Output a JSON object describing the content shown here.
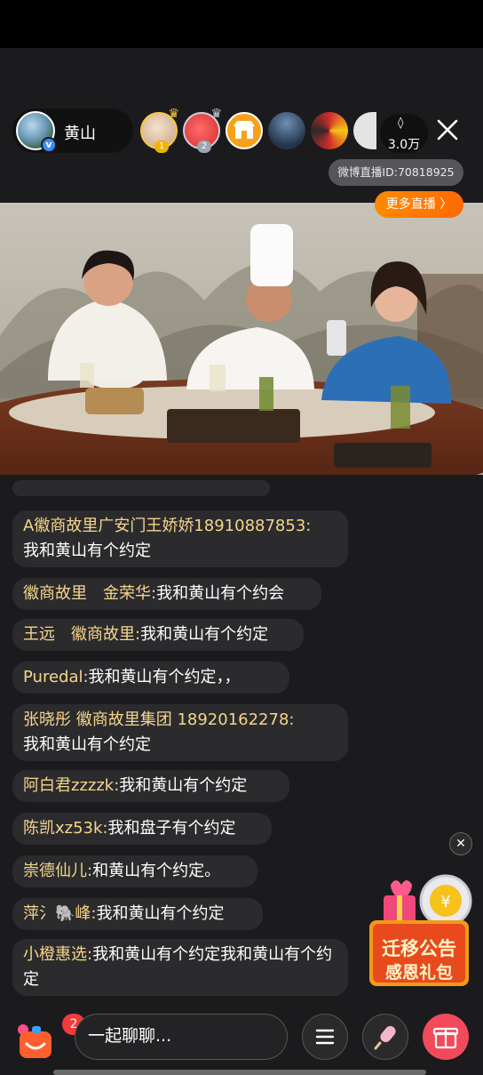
{
  "host": {
    "name": "黄山",
    "verified_mark": "v"
  },
  "viewers": {
    "rank1": "1",
    "rank2": "2",
    "count": "3.0万"
  },
  "room_id": "微博直播ID:70818925",
  "more_live": "更多直播 〉",
  "chat": [
    {
      "user": "A徽商故里广安门王娇娇18910887853:",
      "text": "我和黄山有个约定"
    },
    {
      "user": "徽商故里　金荣华:",
      "text": "我和黄山有个约会"
    },
    {
      "user": "王远　徽商故里:",
      "text": "我和黄山有个约定"
    },
    {
      "user": "Puredal:",
      "text": "我和黄山有个约定，，"
    },
    {
      "user": "张晓彤 徽商故里集团 18920162278:",
      "text": "我和黄山有个约定"
    },
    {
      "user": "阿白君zzzzk:",
      "text": "我和黄山有个约定"
    },
    {
      "user": "陈凯xz53k:",
      "text": "我和盘子有个约定"
    },
    {
      "user": "崇德仙儿:",
      "text": "和黄山有个约定。"
    },
    {
      "user": "萍氵🐘峰:",
      "text": "我和黄山有个约定"
    },
    {
      "user": "小橙惠选:",
      "text": "我和黄山有个约定我和黄山有个约定"
    }
  ],
  "bottom": {
    "cart_badge": "2",
    "input_placeholder": "一起聊聊..."
  },
  "promo": {
    "line1": "迁移公告",
    "line2": "感恩礼包"
  },
  "icons": {
    "close": "close-icon",
    "menu": "menu-icon",
    "popsicle": "popsicle-icon",
    "gift": "gift-icon",
    "cart": "shopping-bag-icon"
  },
  "colors": {
    "username": "#f5d58a",
    "accent_orange": "#ff7a00",
    "gift_red": "#f34a5b",
    "badge_red": "#f23b3b"
  }
}
